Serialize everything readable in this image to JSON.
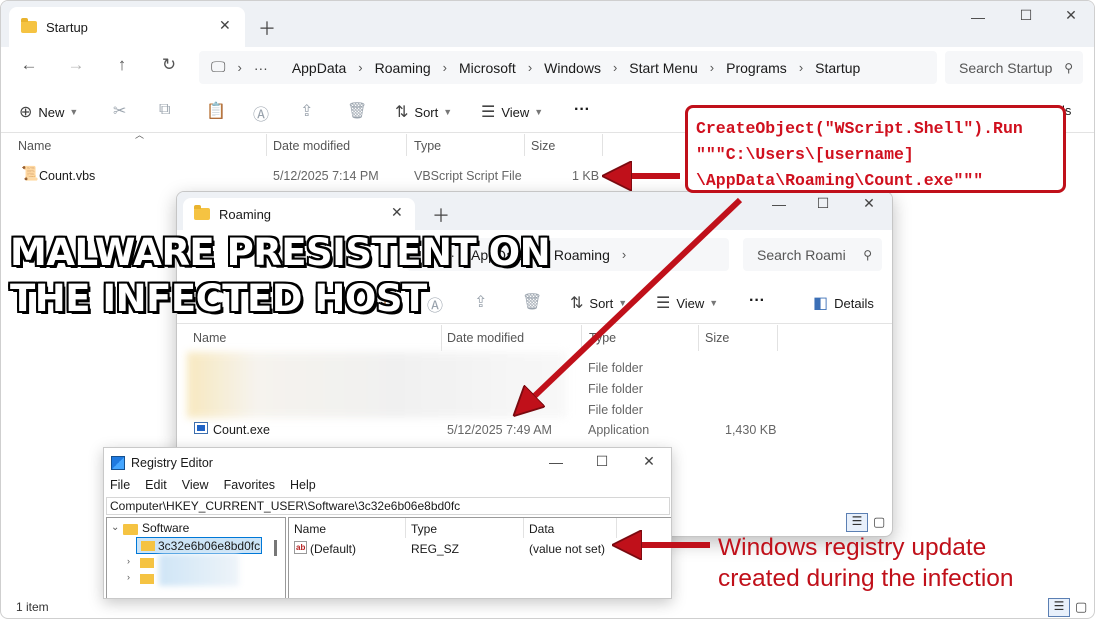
{
  "startup_window": {
    "tab_title": "Startup",
    "breadcrumbs": [
      "AppData",
      "Roaming",
      "Microsoft",
      "Windows",
      "Start Menu",
      "Programs",
      "Startup"
    ],
    "search_placeholder": "Search Startup",
    "toolbar": {
      "new": "New",
      "sort": "Sort",
      "view": "View",
      "details_partial": "ls"
    },
    "columns": [
      "Name",
      "Date modified",
      "Type",
      "Size"
    ],
    "files": [
      {
        "name": "Count.vbs",
        "date": "5/12/2025 7:14 PM",
        "type": "VBScript Script File",
        "size": "1 KB"
      }
    ],
    "status": "1 item"
  },
  "roaming_window": {
    "tab_title": "Roaming",
    "breadcrumbs": [
      "AppData",
      "Roaming"
    ],
    "search_placeholder": "Search Roami",
    "toolbar": {
      "sort": "Sort",
      "view": "View",
      "details": "Details"
    },
    "columns": [
      "Name",
      "Date modified",
      "Type",
      "Size"
    ],
    "rows": [
      {
        "name": "",
        "date": "",
        "type": "File folder",
        "size": ""
      },
      {
        "name": "",
        "date": "",
        "type": "File folder",
        "size": ""
      },
      {
        "name": "",
        "date": "",
        "type": "File folder",
        "size": ""
      },
      {
        "name": "Count.exe",
        "date": "5/12/2025 7:49 AM",
        "type": "Application",
        "size": "1,430 KB"
      }
    ]
  },
  "registry_editor": {
    "title": "Registry Editor",
    "menu": [
      "File",
      "Edit",
      "View",
      "Favorites",
      "Help"
    ],
    "path": "Computer\\HKEY_CURRENT_USER\\Software\\3c32e6b06e8bd0fc",
    "tree": {
      "root": "Software",
      "selected": "3c32e6b06e8bd0fc"
    },
    "columns": [
      "Name",
      "Type",
      "Data"
    ],
    "values": [
      {
        "name": "(Default)",
        "type": "REG_SZ",
        "data": "(value not set)"
      }
    ]
  },
  "annotations": {
    "command_lines": [
      "CreateObject(\"WScript.Shell\").Run",
      "\"\"\"C:\\Users\\[username]",
      "\\AppData\\Roaming\\Count.exe\"\"\""
    ],
    "malware_lines": [
      "MALWARE PRESISTENT ON",
      "THE INFECTED HOST"
    ],
    "registry_note_lines": [
      "Windows registry update",
      "created during the infection"
    ],
    "accent_color": "#c0101a"
  }
}
